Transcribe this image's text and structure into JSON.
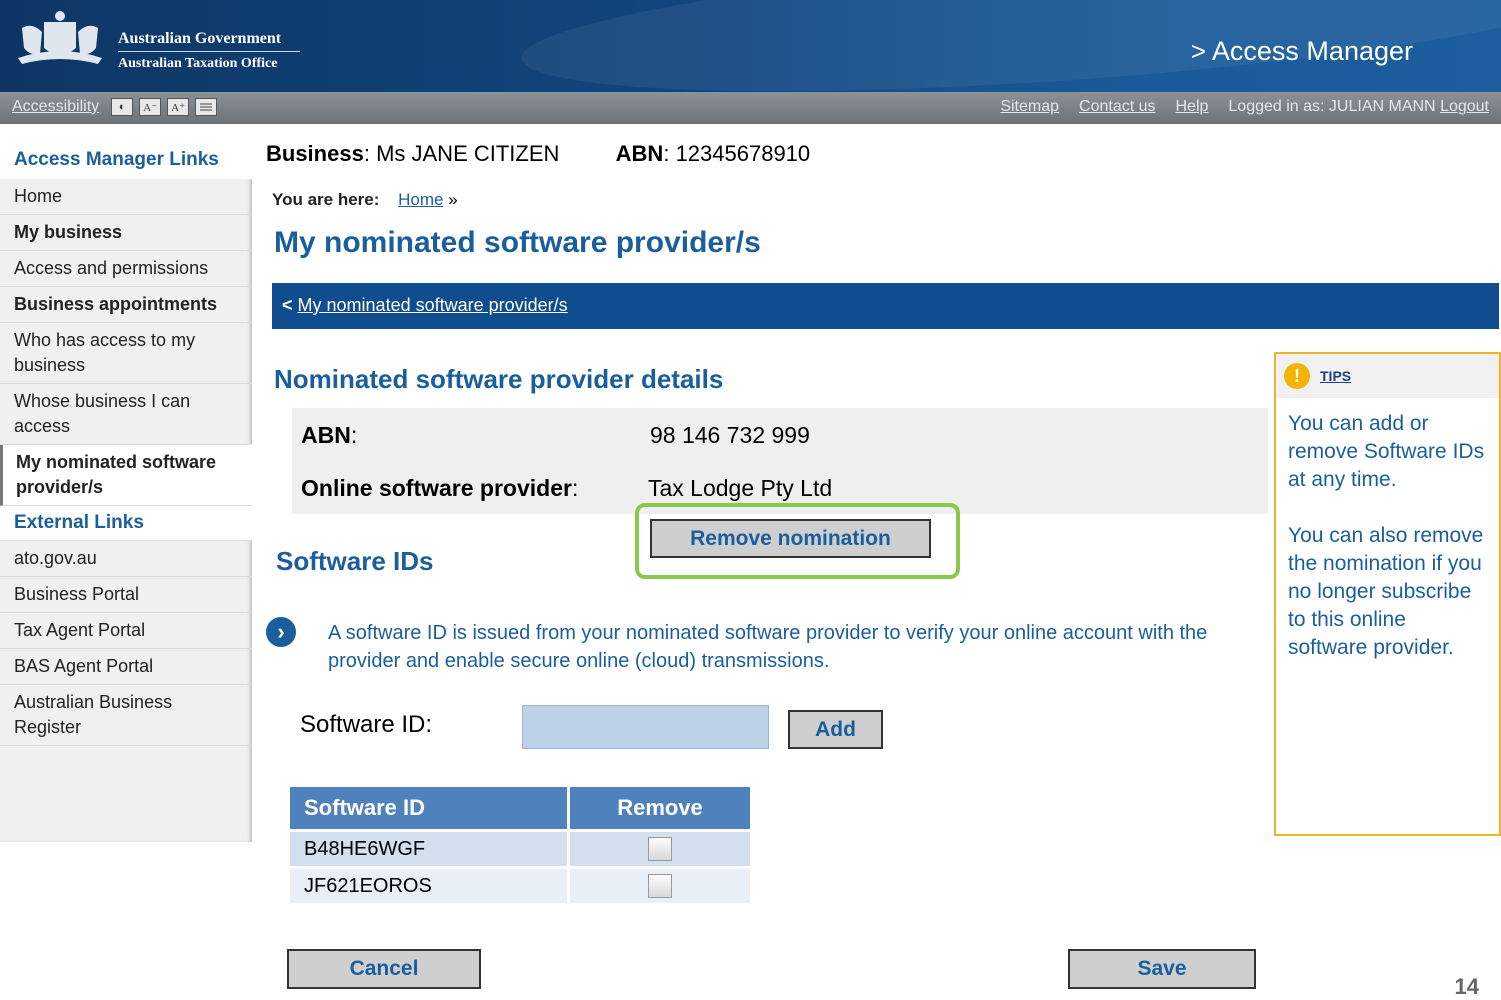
{
  "header": {
    "gov_line1": "Australian Government",
    "gov_line2": "Australian Taxation Office",
    "app_title": "Access Manager"
  },
  "utility": {
    "accessibility": "Accessibility",
    "btn_contrast": "◐",
    "btn_smaller": "A⁻",
    "btn_larger": "A⁺",
    "links": [
      "Sitemap",
      "Contact us",
      "Help"
    ],
    "logged_in_label": "Logged in as: JULIAN MANN",
    "logout": "Logout"
  },
  "sidebar": {
    "title": "Access Manager Links",
    "items": [
      "Home",
      "My business",
      "Access and permissions",
      "Business appointments",
      "Who has access to my business",
      "Whose business I can access",
      "My nominated software provider/s"
    ],
    "external_title": "External Links",
    "external": [
      "ato.gov.au",
      "Business Portal",
      "Tax Agent Portal",
      "BAS Agent Portal",
      "Australian Business Register"
    ]
  },
  "business": {
    "label": "Business",
    "name": "Ms JANE CITIZEN",
    "abn_label": "ABN",
    "abn": "12345678910"
  },
  "breadcrumb": {
    "label": "You are here:",
    "home": "Home",
    "sep": "»"
  },
  "page_title": "My nominated software provider/s",
  "navbar": {
    "back": "<",
    "link": "My nominated software provider/s"
  },
  "details": {
    "title": "Nominated software provider details",
    "abn_label": "ABN",
    "abn_value": "98 146 732 999",
    "provider_label": "Online software provider",
    "provider_value": "Tax Lodge Pty Ltd",
    "remove_button": "Remove nomination"
  },
  "software": {
    "title": "Software IDs",
    "info_icon": "›",
    "info": "A software ID is issued from your nominated software provider to verify your online account with the provider and enable secure online (cloud) transmissions.",
    "input_label": "Software ID:",
    "input_value": "",
    "add_button": "Add",
    "table_headers": [
      "Software ID",
      "Remove"
    ],
    "rows": [
      "B48HE6WGF",
      "JF621EOROS"
    ]
  },
  "tips": {
    "icon": "!",
    "heading": "TIPS",
    "p1": "You can add or remove Software IDs at any time.",
    "p2": "You can also remove the nomination if you no longer subscribe to this online software provider."
  },
  "buttons": {
    "cancel": "Cancel",
    "save": "Save"
  },
  "page_number": "14",
  "colors": {
    "brand_blue": "#1a5e9d",
    "header_dark": "#0d3665",
    "highlight_green": "#8bc84a",
    "tips_border": "#f0b429"
  }
}
